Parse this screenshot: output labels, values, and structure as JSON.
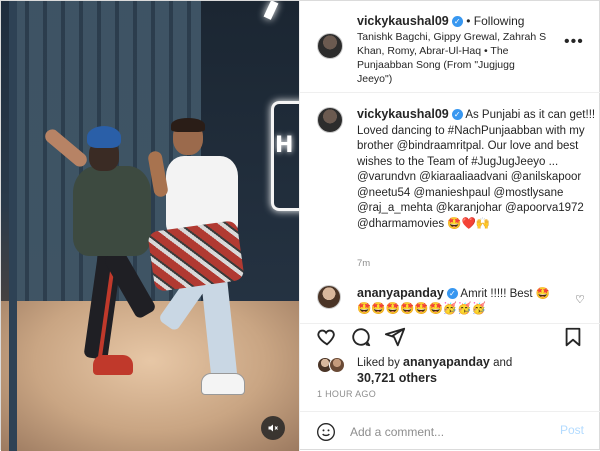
{
  "post": {
    "username": "vickykaushal09",
    "follow_status": "Following",
    "song": "Tanishk Bagchi, Gippy Grewal, Zahrah S Khan, Romy, Abrar-Ul-Haq • The Punjaabban Song (From \"Jugjugg Jeeyo\")",
    "caption_text": "As Punjabi as it can get!!! Loved dancing to #NachPunjaabban with my brother @bindraamritpal. Our love and best wishes to the Team of #JugJugJeeyo ... @varundvn @kiaraaliaadvani @anilskapoor @neetu54 @manieshpaul @mostlysane @raj_a_mehta @karanjohar @apoorva1972 @dharmamovies 🤩❤️🙌",
    "caption_age": "7m"
  },
  "comment": {
    "username": "ananyapanday",
    "text": "Amrit !!!!! Best 🤩",
    "emojis": "🤩🤩🤩🤩🤩🤩🥳🥳🥳"
  },
  "likes": {
    "prefix": "Liked by ",
    "by_user": "ananyapanday",
    "middle": " and",
    "others": "30,721 others"
  },
  "timestamp": "1 HOUR AGO",
  "composer": {
    "placeholder": "Add a comment...",
    "post_label": "Post"
  },
  "photo": {
    "neon_sign": "H"
  },
  "icons": {
    "more": "more-options-icon",
    "like": "heart-icon",
    "comment": "comment-icon",
    "share": "share-icon",
    "save": "bookmark-icon",
    "mute": "mute-icon",
    "emoji": "emoji-icon"
  },
  "colors": {
    "verified": "#3897f0",
    "post_button_disabled": "#b3dbff",
    "muted_text": "#8e8e8e"
  }
}
